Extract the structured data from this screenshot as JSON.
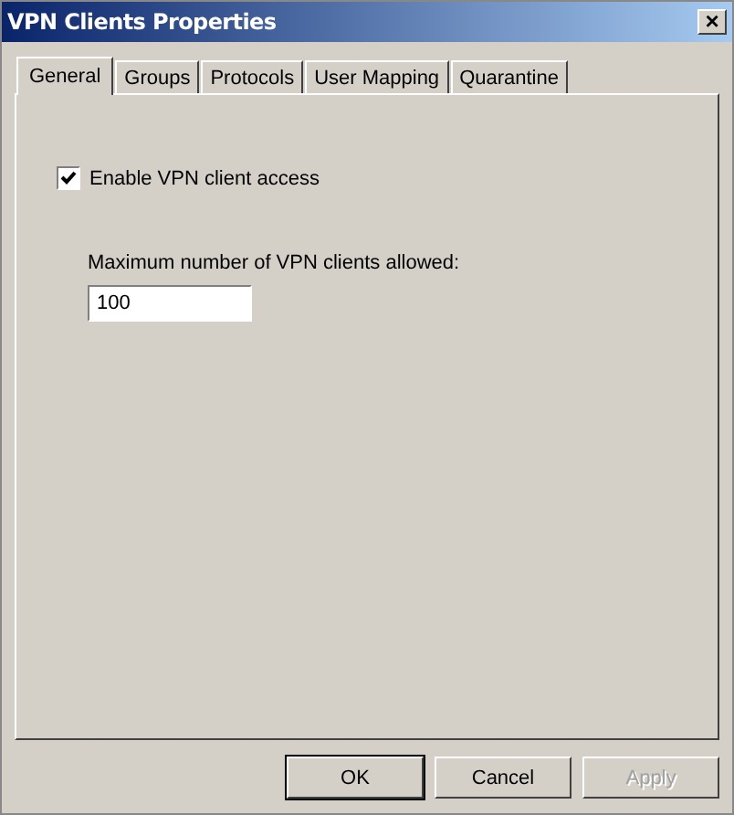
{
  "window": {
    "title": "VPN Clients Properties",
    "close": "×"
  },
  "tabs": [
    {
      "label": "General",
      "selected": true
    },
    {
      "label": "Groups",
      "selected": false
    },
    {
      "label": "Protocols",
      "selected": false
    },
    {
      "label": "User Mapping",
      "selected": false
    },
    {
      "label": "Quarantine",
      "selected": false
    }
  ],
  "enable_access": {
    "label": "Enable VPN client access",
    "checked": true
  },
  "max_clients": {
    "label": "Maximum number of VPN clients allowed:",
    "value": "100"
  },
  "buttons": [
    {
      "label": "OK",
      "disabled": false,
      "default": true
    },
    {
      "label": "Cancel",
      "disabled": false,
      "default": false
    },
    {
      "label": "Apply",
      "disabled": true,
      "default": false
    }
  ]
}
